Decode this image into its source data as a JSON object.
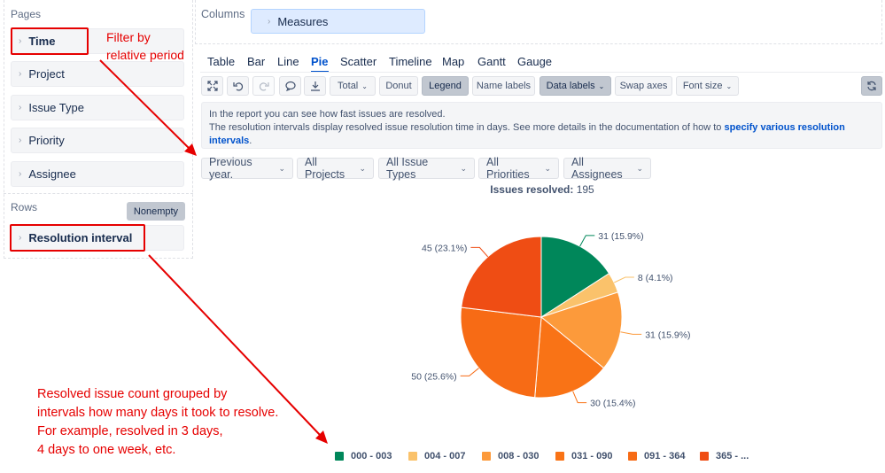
{
  "left": {
    "pages_label": "Pages",
    "pages": [
      "Time",
      "Project",
      "Issue Type",
      "Priority",
      "Assignee"
    ],
    "rows_label": "Rows",
    "nonempty": "Nonempty",
    "rows": [
      "Resolution interval"
    ]
  },
  "columns": {
    "label": "Columns",
    "measures": "Measures"
  },
  "tabs": [
    "Table",
    "Bar",
    "Line",
    "Pie",
    "Scatter",
    "Timeline",
    "Map",
    "Gantt",
    "Gauge"
  ],
  "active_tab": "Pie",
  "toolbar": {
    "total": "Total",
    "donut": "Donut",
    "legend": "Legend",
    "name_labels": "Name labels",
    "data_labels": "Data labels",
    "swap_axes": "Swap axes",
    "font_size": "Font size"
  },
  "info": {
    "line1": "In the report you can see how fast issues are resolved.",
    "line2": "The resolution intervals display resolved issue resolution time in days. See more details in the documentation of how to",
    "link": "specify various resolution intervals",
    "end": "."
  },
  "filters": [
    "Previous year.",
    "All Projects",
    "All Issue Types",
    "All Priorities",
    "All Assignees"
  ],
  "annotations": {
    "a1_line1": "Filter by",
    "a1_line2": "relative period",
    "a2_line1": "Resolved issue count grouped by",
    "a2_line2": "intervals how many days it took to resolve.",
    "a2_line3": "For example, resolved in 3 days,",
    "a2_line4": "4 days to one week, etc."
  },
  "chart_data": {
    "type": "pie",
    "title": "Issues resolved",
    "title_value": "195",
    "slices": [
      {
        "name": "000 - 003",
        "value": 31,
        "label": "31 (15.9%)",
        "color": "#00875a"
      },
      {
        "name": "004 - 007",
        "value": 8,
        "label": "8 (4.1%)",
        "color": "#fac26b"
      },
      {
        "name": "008 - 030",
        "value": 31,
        "label": "31 (15.9%)",
        "color": "#fc9a3b"
      },
      {
        "name": "031 - 090",
        "value": 30,
        "label": "30 (15.4%)",
        "color": "#f97316"
      },
      {
        "name": "091 - 364",
        "value": 50,
        "label": "50 (25.6%)",
        "color": "#f76b15"
      },
      {
        "name": "365 - ...",
        "value": 45,
        "label": "45 (23.1%)",
        "color": "#ef4d14"
      }
    ],
    "legend_position": "bottom"
  },
  "colors": {
    "accent": "#0052cc",
    "annotation": "#e60000"
  }
}
